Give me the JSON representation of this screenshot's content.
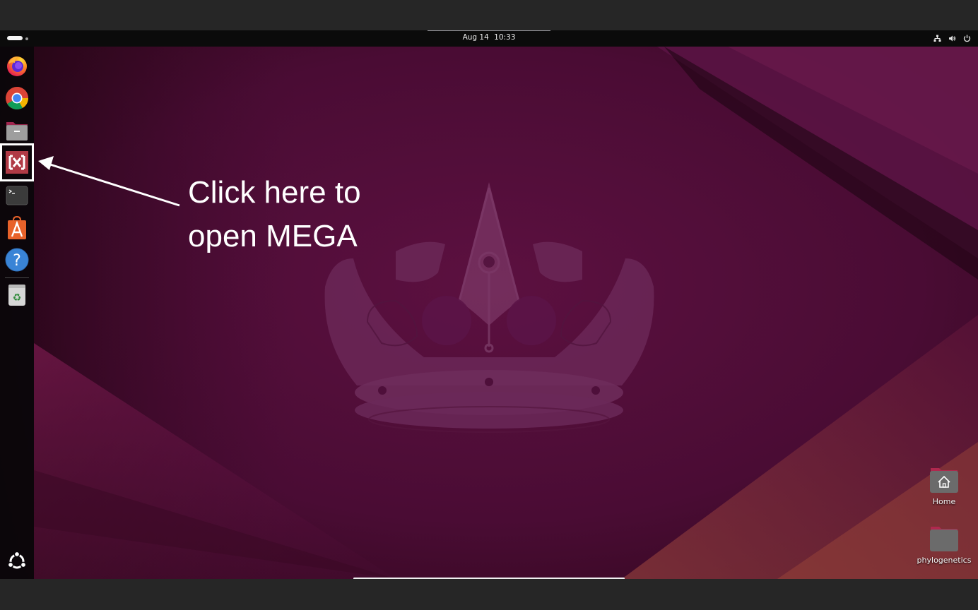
{
  "top_panel": {
    "date": "Aug 14",
    "time": "10:33",
    "tray_icons": [
      "network-icon",
      "volume-icon",
      "power-icon"
    ]
  },
  "dock": {
    "apps": [
      {
        "name": "firefox-icon"
      },
      {
        "name": "chrome-icon"
      },
      {
        "name": "files-icon"
      },
      {
        "name": "mega-icon"
      },
      {
        "name": "terminal-icon"
      },
      {
        "name": "app-center-icon"
      },
      {
        "name": "help-icon"
      },
      {
        "name": "trash-icon"
      }
    ],
    "show_apps": "ubuntu-show-apps-icon"
  },
  "annotation": {
    "line1": "Click here to",
    "line2": "open MEGA"
  },
  "desktop": {
    "icons": [
      {
        "label": "Home",
        "icon": "home-folder-icon"
      },
      {
        "label": "phylogenetics",
        "icon": "folder-icon"
      }
    ]
  },
  "colors": {
    "wallpaper_dark": "#2a0716",
    "wallpaper_mid": "#5a1040",
    "wallpaper_accent": "#7a1b3c",
    "mega_red": "#b03a45",
    "annotation": "#ffffff"
  }
}
